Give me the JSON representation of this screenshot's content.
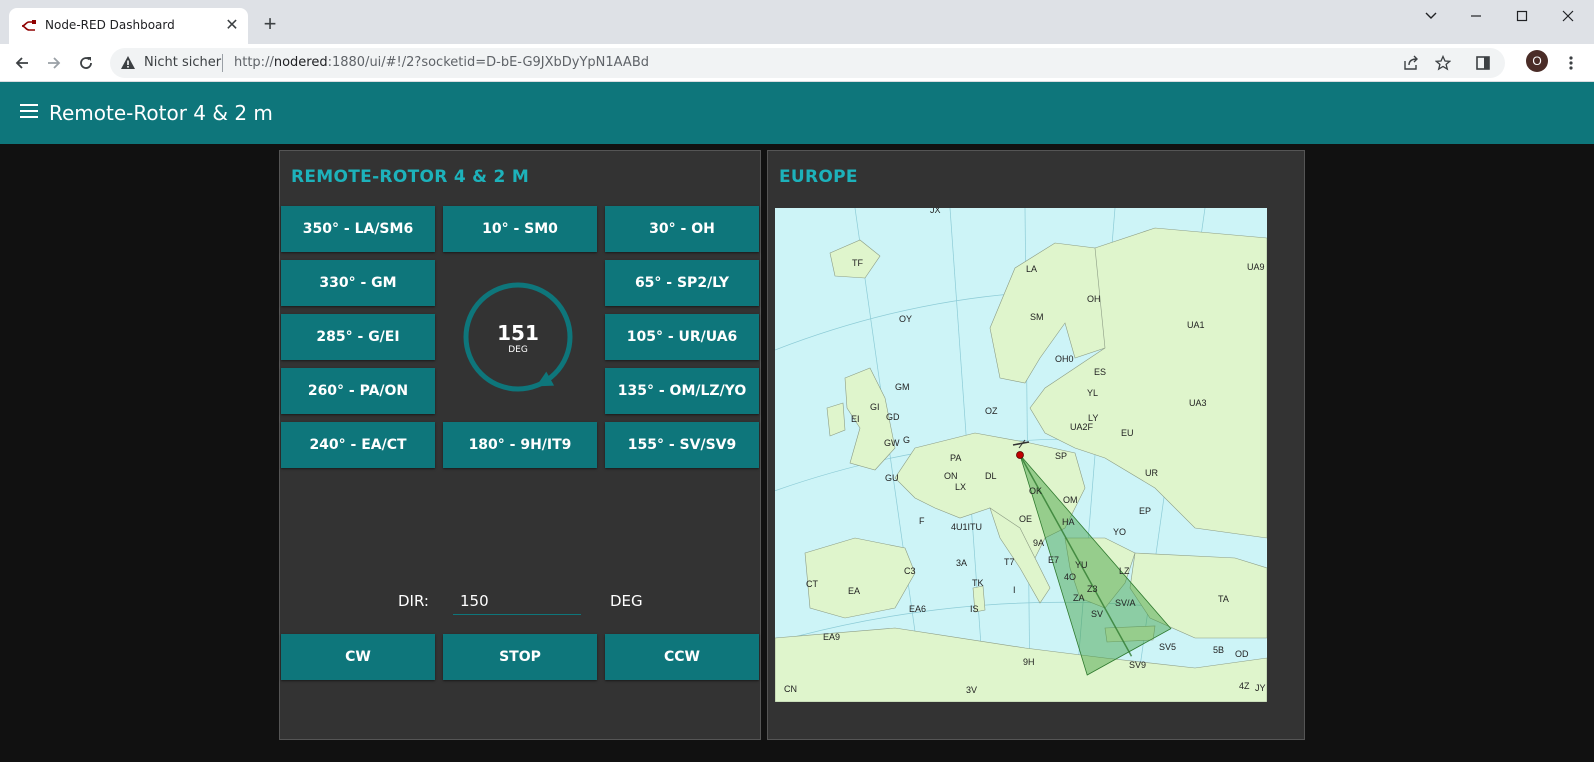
{
  "browser": {
    "tab_title": "Node-RED Dashboard",
    "security_label": "Nicht sicher",
    "url_prefix": "http://",
    "url_host": "nodered",
    "url_rest": ":1880/ui/#!/2?socketid=D-bE-G9JXbDyYpN1AABd",
    "profile_initial": "O"
  },
  "dashboard": {
    "title": "Remote-Rotor 4 & 2 m"
  },
  "rotor_group": {
    "title": "REMOTE-ROTOR 4 & 2 M",
    "presets": [
      "350° - LA/SM6",
      "10° - SM0",
      "30° - OH",
      "330° - GM",
      "65° - SP2/LY",
      "285° - G/EI",
      "105° - UR/UA6",
      "260° - PA/ON",
      "135° - OM/LZ/YO",
      "240° - EA/CT",
      "180° - 9H/IT9",
      "155° - SV/SV9"
    ],
    "gauge": {
      "value": "151",
      "unit": "DEG",
      "angle_deg": 151,
      "color": "#0e767b"
    },
    "dir_label": "DIR:",
    "dir_value": "150",
    "dir_unit": "DEG",
    "controls": [
      "CW",
      "STOP",
      "CCW"
    ]
  },
  "map_group": {
    "title": "EUROPE",
    "beam_bearing_deg": 151,
    "prefix_labels": [
      "JX",
      "TF",
      "LA",
      "UA9",
      "OH",
      "OY",
      "SM",
      "UA1",
      "OH0",
      "ES",
      "GM",
      "GI",
      "GD",
      "EI",
      "GW",
      "G",
      "OZ",
      "YL",
      "UA3",
      "LY",
      "UA2F",
      "EU",
      "SP",
      "PA",
      "UR",
      "ON",
      "LX",
      "DL",
      "OK",
      "OM",
      "GU",
      "F",
      "4U1ITU",
      "OE",
      "HA",
      "EP",
      "9A",
      "YO",
      "T7",
      "E7",
      "YU",
      "4O",
      "LZ",
      "Z3",
      "ZA",
      "SV/A",
      "SV",
      "C3",
      "3A",
      "TK",
      "CT",
      "EA",
      "I",
      "EA6",
      "IS",
      "TA",
      "EA9",
      "SV5",
      "5B",
      "OD",
      "9H",
      "SV9",
      "CN",
      "3V",
      "4Z",
      "JY"
    ],
    "colors": {
      "sea": "#cdf4f7",
      "land": "#dff5cc",
      "beam": "#3d9e3d"
    }
  },
  "colors": {
    "accent": "#0e767b",
    "title_accent": "#1db2bb",
    "group_bg": "#333333",
    "page_bg": "#111111"
  }
}
